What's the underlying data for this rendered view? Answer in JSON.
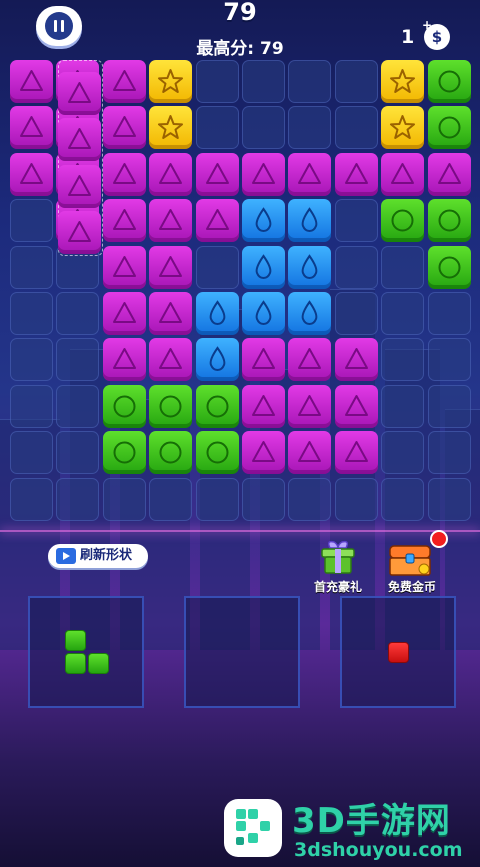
{
  "header": {
    "score": "79",
    "best_score_label": "最高分: 79",
    "coins": "1",
    "coin_symbol": "$",
    "coin_plus": "+"
  },
  "board": {
    "rows": [
      [
        "tri",
        "tri",
        "tri",
        "star",
        "",
        "",
        "",
        "",
        "star",
        "circ"
      ],
      [
        "tri",
        "tri",
        "tri",
        "star",
        "",
        "",
        "",
        "",
        "star",
        "circ"
      ],
      [
        "tri",
        "tri",
        "tri",
        "tri",
        "tri",
        "tri",
        "tri",
        "tri",
        "tri",
        "tri"
      ],
      [
        "",
        "tri",
        "tri",
        "tri",
        "tri",
        "drop",
        "drop",
        "",
        "circ",
        "circ"
      ],
      [
        "",
        "",
        "tri",
        "tri",
        "",
        "drop",
        "drop",
        "",
        "",
        "circ"
      ],
      [
        "",
        "",
        "tri",
        "tri",
        "drop",
        "drop",
        "drop",
        "",
        "",
        ""
      ],
      [
        "",
        "",
        "tri",
        "tri",
        "drop",
        "tri",
        "tri",
        "tri",
        "",
        ""
      ],
      [
        "",
        "",
        "circ",
        "circ",
        "circ",
        "tri",
        "tri",
        "tri",
        "",
        ""
      ],
      [
        "",
        "",
        "circ",
        "circ",
        "circ",
        "tri",
        "tri",
        "tri",
        "",
        ""
      ],
      [
        "",
        "",
        "",
        "",
        "",
        "",
        "",
        "",
        "",
        ""
      ]
    ],
    "dragging_piece": [
      "tri",
      "tri",
      "tri",
      "tri"
    ],
    "colors": {
      "tri": "#d22ad8",
      "drop": "#2a8cf0",
      "circ": "#3cc41c",
      "star": "#f8cc10"
    }
  },
  "actions": {
    "refresh_label": "刷新形状",
    "gift_label": "首充豪礼",
    "free_coins_label": "免费金币"
  },
  "pieces": [
    {
      "shape": "green-tetromino"
    },
    {
      "shape": "empty"
    },
    {
      "shape": "red-single"
    }
  ],
  "watermark": {
    "title": "3D手游网",
    "url": "3dshouyou.com"
  }
}
